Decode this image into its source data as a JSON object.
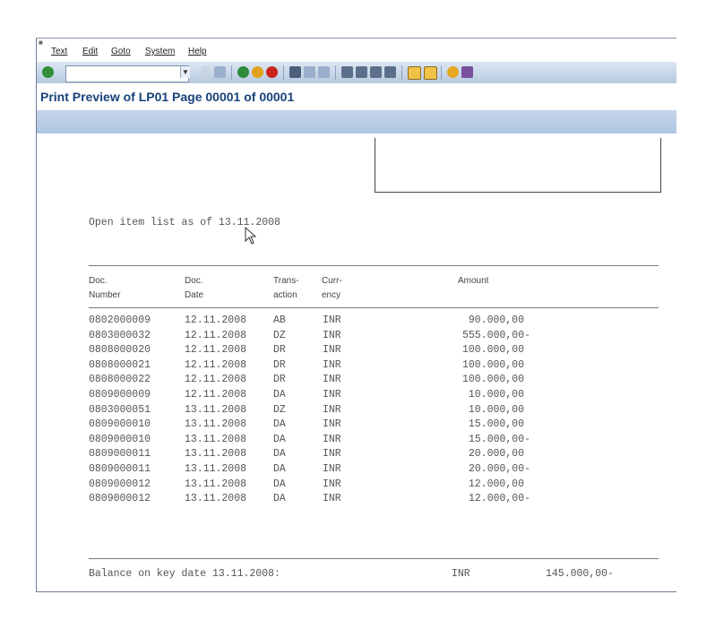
{
  "menu": {
    "items": [
      "Text",
      "Edit",
      "Goto",
      "System",
      "Help"
    ]
  },
  "toolbar": {
    "command_value": "",
    "icons": [
      "enter-icon",
      "save-icon",
      "back-icon",
      "exit-icon",
      "cancel-icon",
      "print-icon",
      "find-icon",
      "find-next-icon",
      "first-page-icon",
      "prev-page-icon",
      "next-page-icon",
      "last-page-icon",
      "create-session-icon",
      "shortcut-icon",
      "help-icon",
      "customize-icon"
    ]
  },
  "title": "Print Preview of LP01 Page 00001 of 00001",
  "report": {
    "heading": "Open item list as of 13.11.2008",
    "columns": {
      "doc_number": [
        "Doc.",
        "Number"
      ],
      "doc_date": [
        "Doc.",
        "Date"
      ],
      "transaction": [
        "Trans-",
        "action"
      ],
      "currency": [
        "Curr-",
        "ency"
      ],
      "amount": "Amount"
    },
    "rows": [
      {
        "number": "0802000009",
        "date": "12.11.2008",
        "trans": "AB",
        "curr": "INR",
        "amount": "90.000,00"
      },
      {
        "number": "0803000032",
        "date": "12.11.2008",
        "trans": "DZ",
        "curr": "INR",
        "amount": "555.000,00-"
      },
      {
        "number": "0808000020",
        "date": "12.11.2008",
        "trans": "DR",
        "curr": "INR",
        "amount": "100.000,00"
      },
      {
        "number": "0808000021",
        "date": "12.11.2008",
        "trans": "DR",
        "curr": "INR",
        "amount": "100.000,00"
      },
      {
        "number": "0808000022",
        "date": "12.11.2008",
        "trans": "DR",
        "curr": "INR",
        "amount": "100.000,00"
      },
      {
        "number": "0809000009",
        "date": "12.11.2008",
        "trans": "DA",
        "curr": "INR",
        "amount": "10.000,00"
      },
      {
        "number": "0803000051",
        "date": "13.11.2008",
        "trans": "DZ",
        "curr": "INR",
        "amount": "10.000,00"
      },
      {
        "number": "0809000010",
        "date": "13.11.2008",
        "trans": "DA",
        "curr": "INR",
        "amount": "15.000,00"
      },
      {
        "number": "0809000010",
        "date": "13.11.2008",
        "trans": "DA",
        "curr": "INR",
        "amount": "15.000,00-"
      },
      {
        "number": "0809000011",
        "date": "13.11.2008",
        "trans": "DA",
        "curr": "INR",
        "amount": "20.000,00"
      },
      {
        "number": "0809000011",
        "date": "13.11.2008",
        "trans": "DA",
        "curr": "INR",
        "amount": "20.000,00-"
      },
      {
        "number": "0809000012",
        "date": "13.11.2008",
        "trans": "DA",
        "curr": "INR",
        "amount": "12.000,00"
      },
      {
        "number": "0809000012",
        "date": "13.11.2008",
        "trans": "DA",
        "curr": "INR",
        "amount": "12.000,00-"
      }
    ],
    "balance": {
      "label": "Balance on key date 13.11.2008:",
      "currency": "INR",
      "amount": "145.000,00-"
    }
  }
}
